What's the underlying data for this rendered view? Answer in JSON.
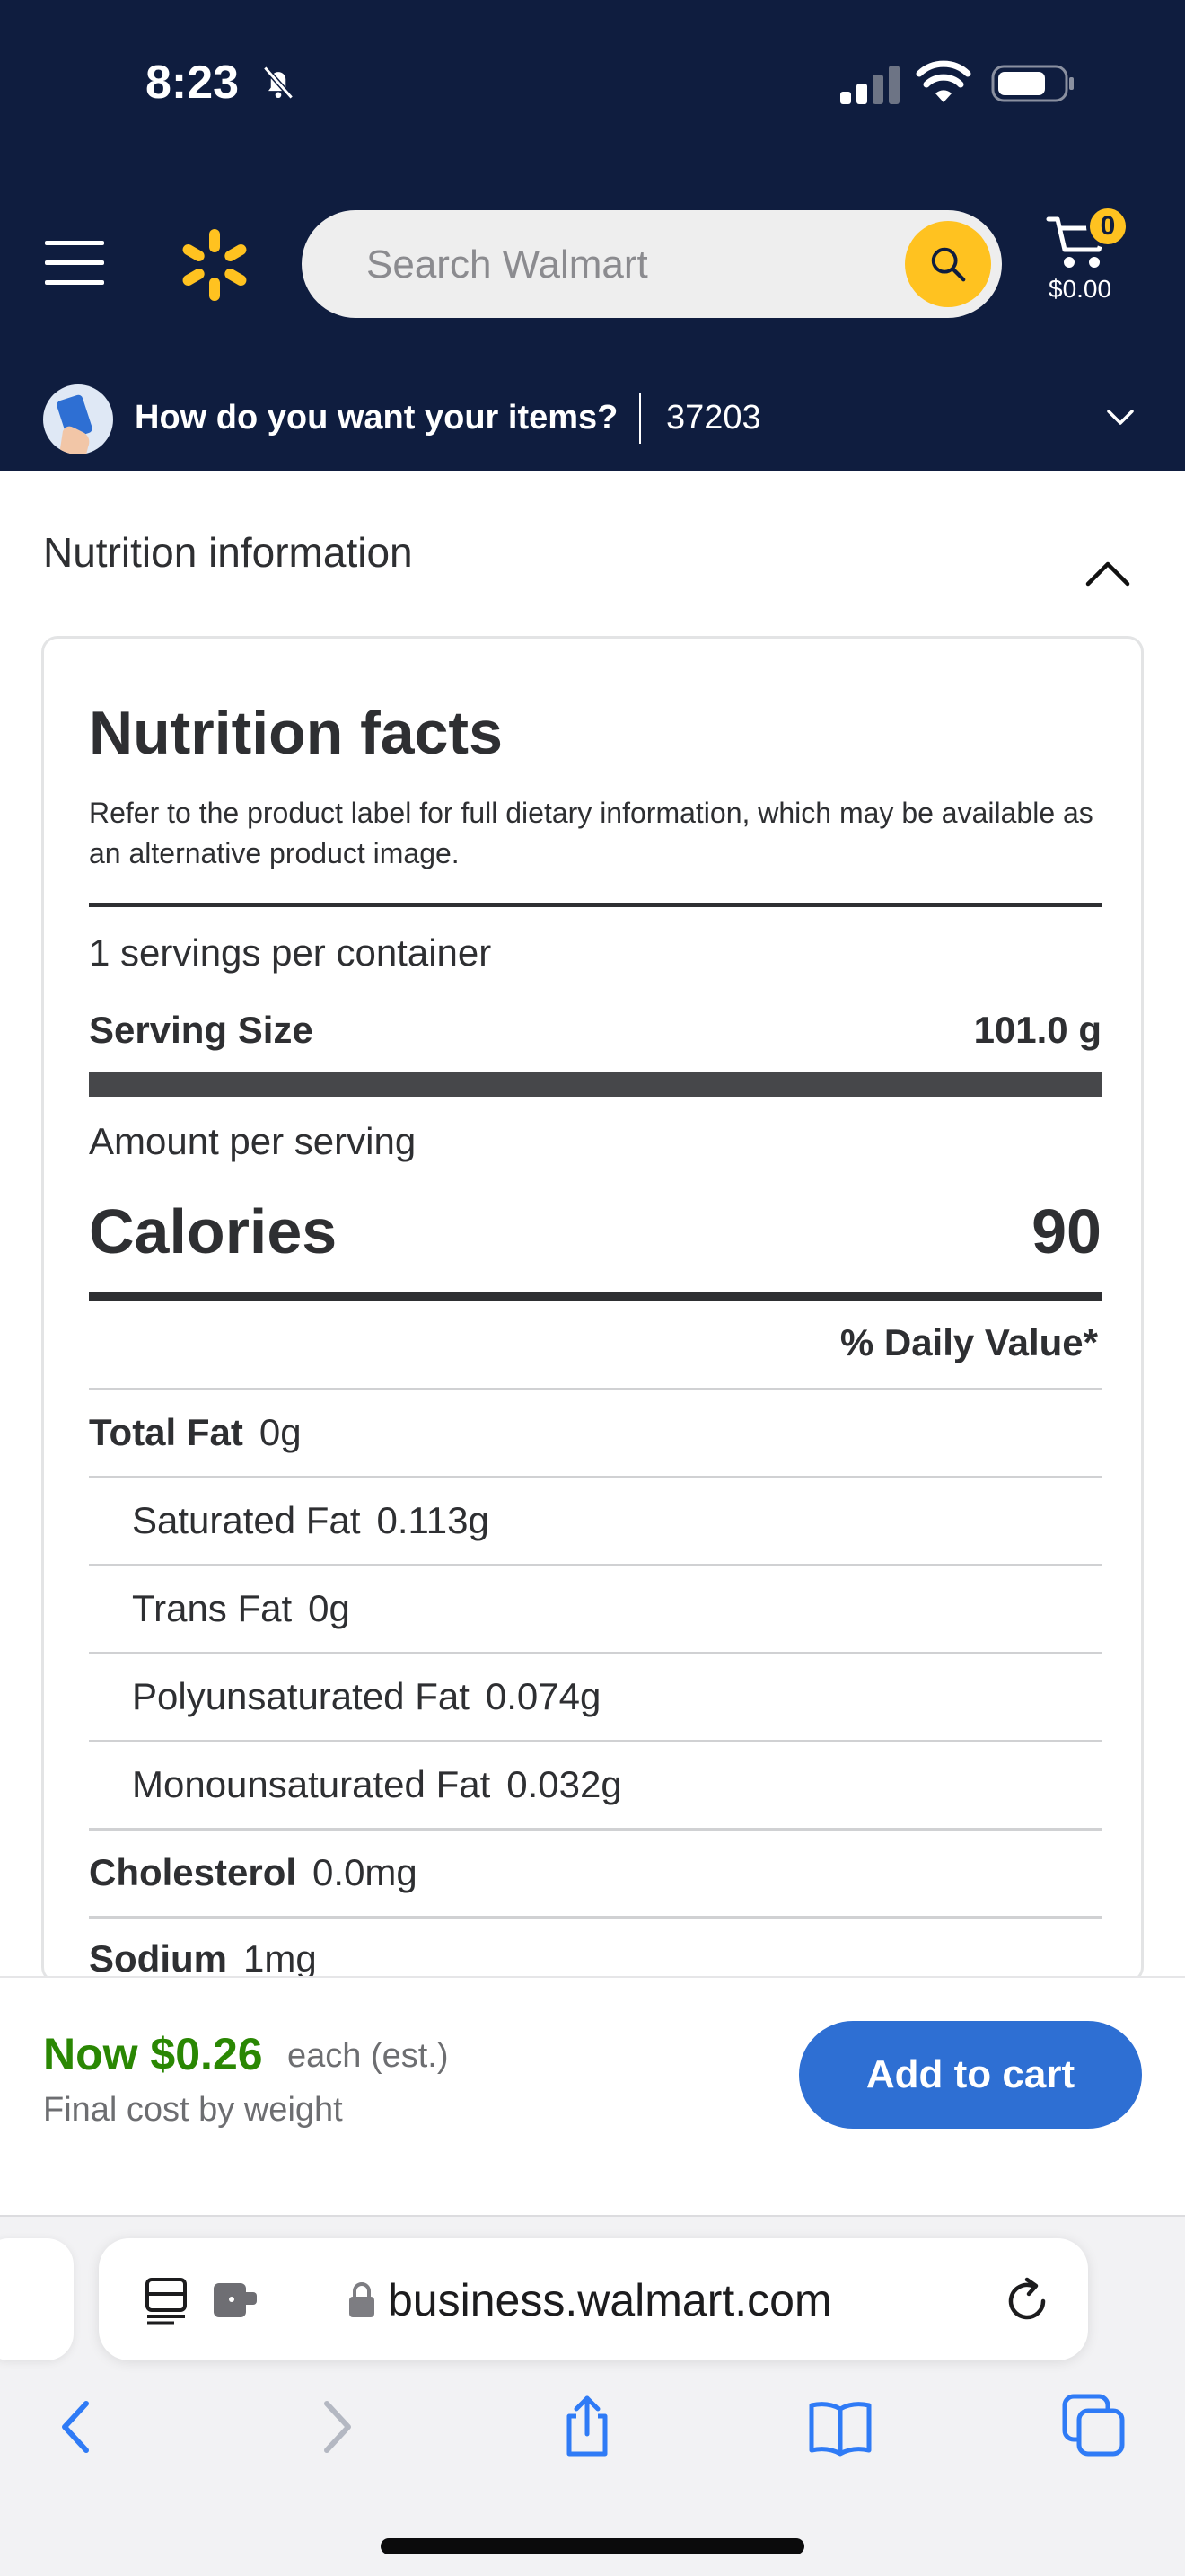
{
  "status_bar": {
    "time": "8:23"
  },
  "header": {
    "search_placeholder": "Search Walmart",
    "cart_count": "0",
    "cart_total": "$0.00"
  },
  "fulfillment": {
    "question": "How do you want your items?",
    "zip": "37203"
  },
  "section": {
    "title": "Nutrition information"
  },
  "nutrition": {
    "title": "Nutrition facts",
    "note": "Refer to the product label for full dietary information, which may be available as an alternative product image.",
    "servings_per_container": "1 servings per container",
    "serving_size_label": "Serving Size",
    "serving_size_value": "101.0 g",
    "amount_per_serving": "Amount per serving",
    "calories_label": "Calories",
    "calories_value": "90",
    "daily_value_header": "% Daily Value*",
    "rows": [
      {
        "name": "Total Fat",
        "amount": "0g"
      },
      {
        "name": "Saturated Fat",
        "amount": "0.113g"
      },
      {
        "name": "Trans Fat",
        "amount": "0g"
      },
      {
        "name": "Polyunsaturated Fat",
        "amount": "0.074g"
      },
      {
        "name": "Monounsaturated Fat",
        "amount": "0.032g"
      },
      {
        "name": "Cholesterol",
        "amount": "0.0mg"
      },
      {
        "name": "Sodium",
        "amount": "1mg"
      }
    ]
  },
  "buy_bar": {
    "price": "Now $0.26",
    "unit": "each (est.)",
    "note": "Final cost by weight",
    "add_to_cart": "Add to cart"
  },
  "browser": {
    "url": "business.walmart.com"
  },
  "colors": {
    "header_bg": "#0f1d3f",
    "accent_yellow": "#ffc220",
    "price_green": "#2a8703",
    "button_blue": "#2e6fd3",
    "safari_blue": "#2f7bf6"
  }
}
